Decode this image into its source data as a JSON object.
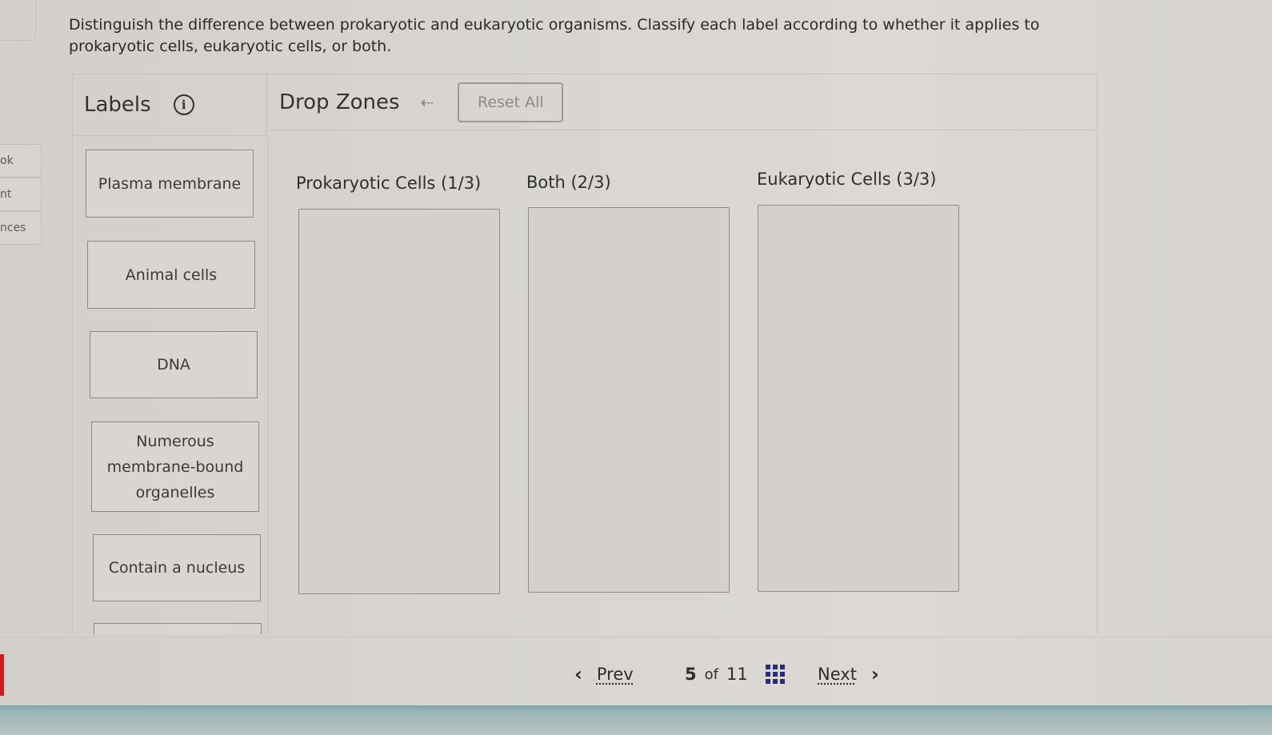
{
  "instructions": "Distinguish the difference between prokaryotic and eukaryotic organisms. Classify each label according to whether it applies to prokaryotic cells, eukaryotic cells, or both.",
  "left_nav": [
    "ok",
    "nt",
    "nces"
  ],
  "labels_panel": {
    "title": "Labels",
    "info_icon": "info-icon"
  },
  "drop_panel": {
    "title": "Drop Zones",
    "undo_icon": "undo-arrow-icon",
    "reset_label": "Reset All"
  },
  "labels": [
    {
      "text": "Plasma membrane"
    },
    {
      "text": "Animal cells"
    },
    {
      "text": "DNA"
    },
    {
      "text": "Numerous membrane-bound organelles"
    },
    {
      "text": "Contain a nucleus"
    },
    {
      "text": ""
    }
  ],
  "drop_zones": [
    {
      "title": "Prokaryotic Cells (1/3)"
    },
    {
      "title": "Both (2/3)"
    },
    {
      "title": "Eukaryotic Cells (3/3)"
    }
  ],
  "footer": {
    "prev_label": "Prev",
    "page_current": "5",
    "page_of": "of",
    "page_total": "11",
    "next_label": "Next",
    "grid_icon": "grid-icon"
  }
}
